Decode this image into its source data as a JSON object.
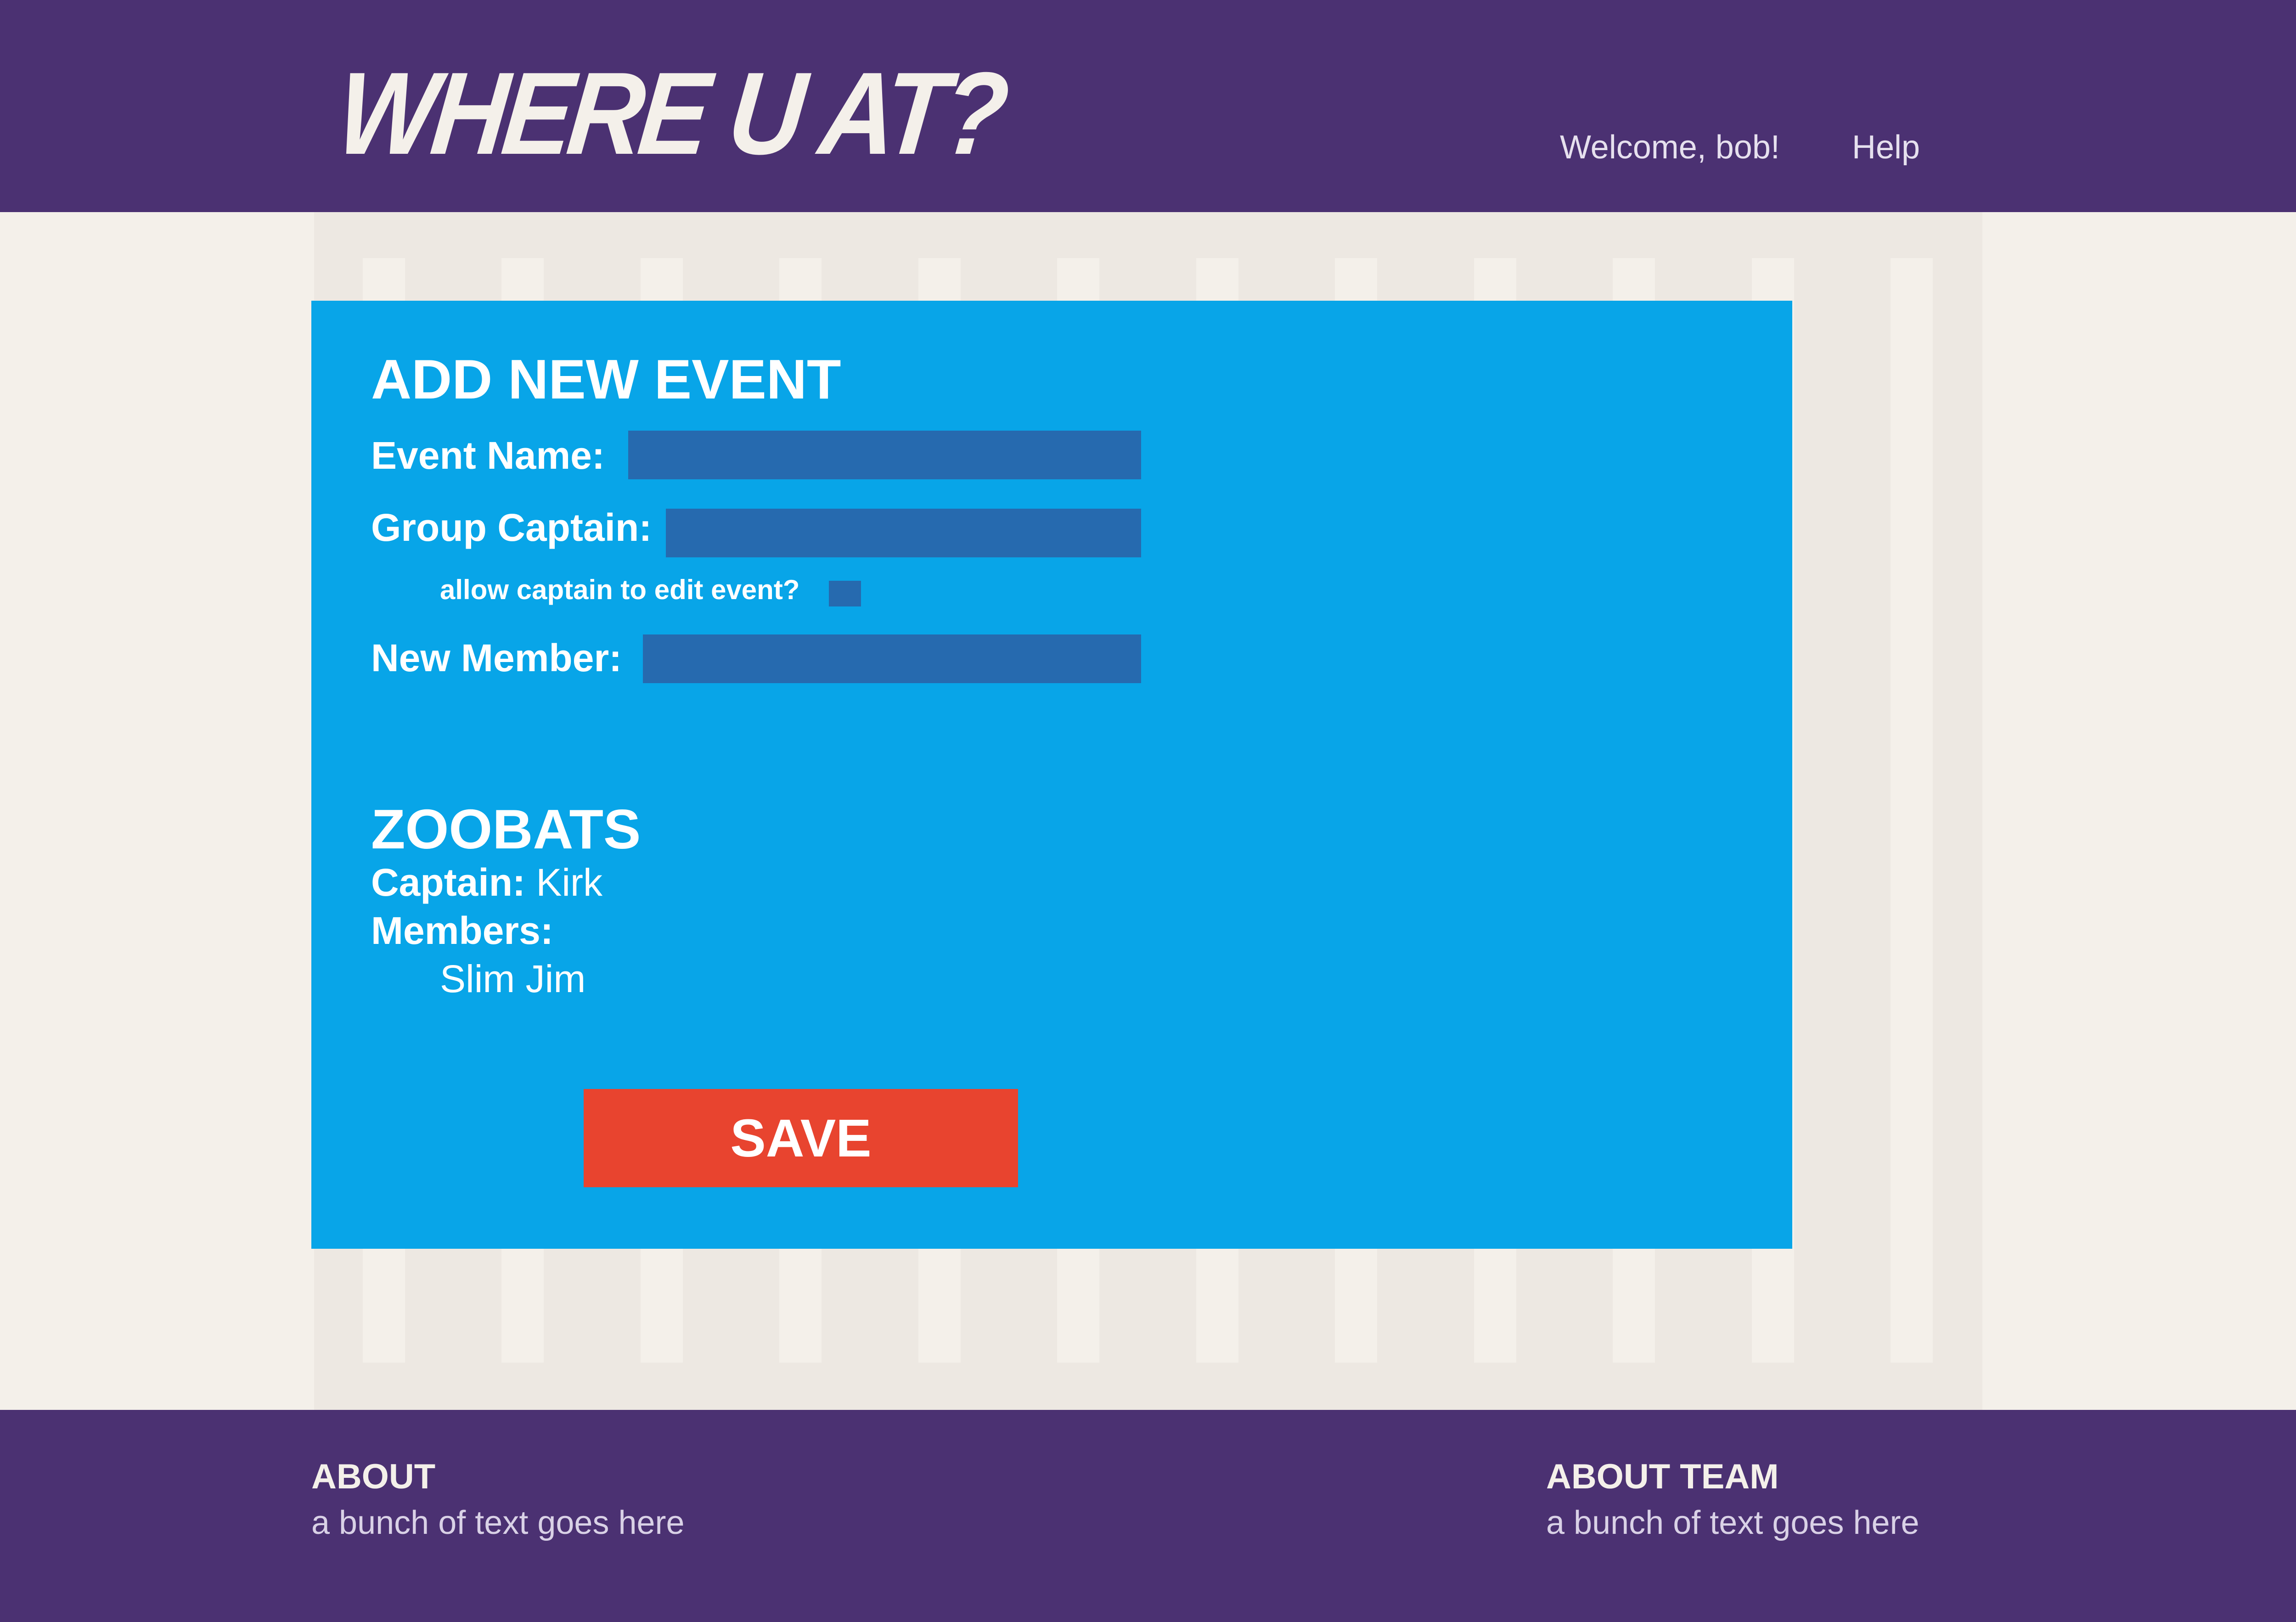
{
  "colors": {
    "header_bg": "#4b3172",
    "page_bg": "#f4f0ea",
    "card_bg": "#08a5e8",
    "field_bg": "#266aaf",
    "save_bg": "#e8442f"
  },
  "header": {
    "logo": "WHERE U AT?",
    "welcome": "Welcome, bob!",
    "help": "Help"
  },
  "form": {
    "title": "ADD NEW EVENT",
    "event_name_label": "Event Name:",
    "event_name_value": "",
    "group_captain_label": "Group Captain:",
    "group_captain_value": "",
    "allow_edit_label": "allow captain to edit event?",
    "allow_edit_checked": false,
    "new_member_label": "New Member:",
    "new_member_value": ""
  },
  "team": {
    "name": "ZOOBATS",
    "captain_label": "Captain:",
    "captain_value": "Kirk",
    "members_label": "Members:",
    "members": [
      "Slim Jim"
    ]
  },
  "save_label": "SAVE",
  "footer": {
    "about_title": "ABOUT",
    "about_text": "a bunch of text goes here",
    "about_team_title": "ABOUT TEAM",
    "about_team_text": "a bunch of text goes here"
  }
}
